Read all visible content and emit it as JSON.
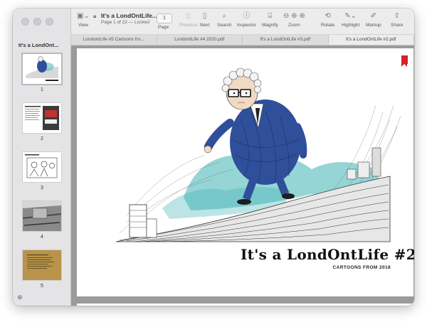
{
  "sidebar": {
    "title": "It's a LondOnt...",
    "thumbnails": [
      {
        "label": "1",
        "selected": true
      },
      {
        "label": "2",
        "selected": false
      },
      {
        "label": "3",
        "selected": false
      },
      {
        "label": "4",
        "selected": false
      },
      {
        "label": "5",
        "selected": false
      }
    ]
  },
  "toolbar": {
    "view_label": "View",
    "document_title": "It's a LondOntLife...",
    "document_subtitle": "Page 1 of 22 — Locked",
    "page_number": "1",
    "page_label": "Page",
    "previous_label": "Previous",
    "next_label": "Next",
    "search_label": "Search",
    "inspector_label": "Inspector",
    "magnify_label": "Magnify",
    "zoom_label": "Zoom",
    "rotate_label": "Rotate",
    "highlight_label": "Highlight",
    "markup_label": "Markup",
    "share_label": "Share"
  },
  "tabs": [
    {
      "label": "LondontLife #5 Cartoons fro...",
      "active": false
    },
    {
      "label": "LondontLife #4 2020.pdf",
      "active": false
    },
    {
      "label": "It's a LondOntLife #3.pdf",
      "active": false
    },
    {
      "label": "It's a LondOntLife #2.pdf",
      "active": true
    }
  ],
  "page": {
    "cover_title": "It's a LondOntLife #2",
    "cover_subtitle": "CARTOONS FROM 2018"
  },
  "colors": {
    "bookmark": "#d6202a",
    "teal_wash": "#3fb3b4",
    "suit_blue": "#2f4f9a"
  }
}
